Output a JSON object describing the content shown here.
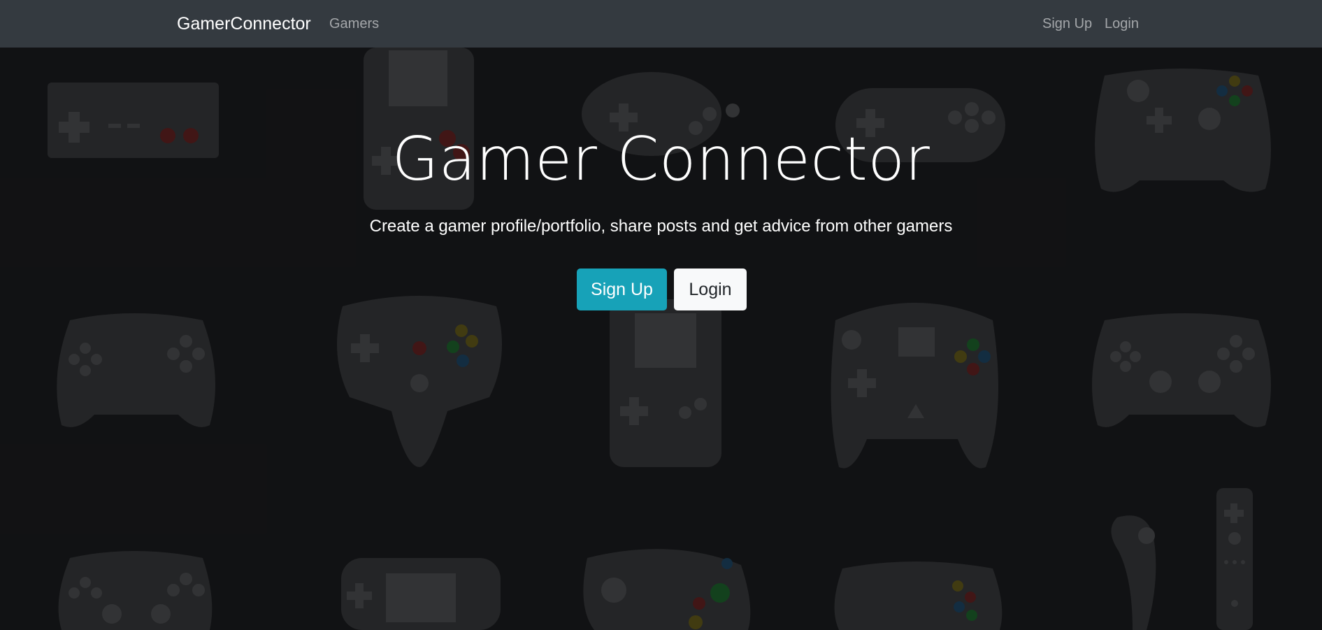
{
  "navbar": {
    "brand": "GamerConnector",
    "links": {
      "gamers": "Gamers",
      "signup": "Sign Up",
      "login": "Login"
    }
  },
  "hero": {
    "title": "Gamer Connector",
    "lead": "Create a gamer profile/portfolio, share posts and get advice from other gamers",
    "buttons": {
      "signup": "Sign Up",
      "login": "Login"
    }
  },
  "colors": {
    "navbar_bg": "#343a40",
    "page_bg": "#141517",
    "signup_button": "#17a2b8",
    "login_button": "#f8f9fa",
    "controller_art": "#2c2d2f"
  }
}
